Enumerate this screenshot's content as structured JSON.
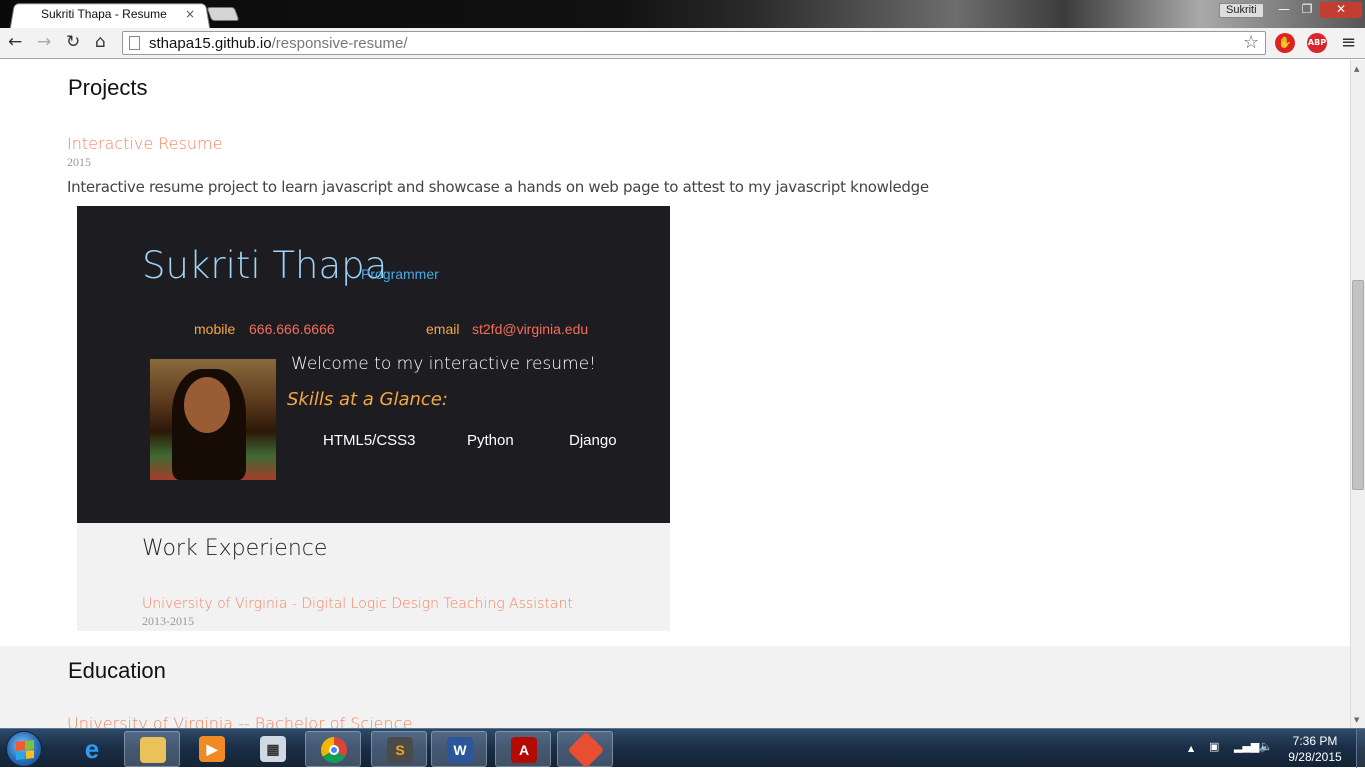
{
  "browser": {
    "tab_title": "Sukriti Thapa - Resume",
    "tab_close": "×",
    "profile_name": "Sukriti",
    "url_domain": "sthapa15.github.io",
    "url_path": "/responsive-resume/",
    "window_min": "—",
    "window_max": "❐",
    "window_close": "✕",
    "back": "←",
    "forward": "→",
    "reload": "↻",
    "home": "⌂",
    "star": "☆",
    "menu": "≡",
    "ext_stop": "✋",
    "ext_abp": "ABP",
    "icons": [
      "back-icon",
      "forward-icon",
      "reload-icon",
      "home-icon",
      "page-icon",
      "star-icon",
      "adblock-icon",
      "menu-icon"
    ]
  },
  "page": {
    "projects_title": "Projects",
    "project": {
      "title": "Interactive Resume",
      "date": "2015",
      "description": "Interactive resume project to learn javascript and showcase a hands on web page to attest to my javascript knowledge"
    },
    "preview": {
      "name": "Sukriti Thapa",
      "role": "Programmer",
      "mobile_label": "mobile",
      "mobile_value": "666.666.6666",
      "email_label": "email",
      "email_value": "st2fd@virginia.edu",
      "welcome": "Welcome to my interactive resume!",
      "skills_title": "Skills at a Glance:",
      "skills": [
        "HTML5/CSS3",
        "Python",
        "Django"
      ],
      "work_title": "Work Experience",
      "work_link": "University of Virginia - Digital Logic Design Teaching Assistant",
      "work_date": "2013-2015"
    },
    "education_title": "Education",
    "education_link": "University of Virginia -- Bachelor of Science"
  },
  "taskbar": {
    "apps": [
      "Internet Explorer",
      "Windows Explorer",
      "Media Player",
      "Calculator",
      "Google Chrome",
      "Sublime Text",
      "Microsoft Word",
      "Adobe Reader",
      "Git"
    ],
    "tray_arrow": "▲",
    "time": "7:36 PM",
    "date": "9/28/2015"
  },
  "colors": {
    "accent_orange": "#f5845e",
    "preview_dark": "#1d1c21",
    "name_blue": "#9fd4f6",
    "label_amber": "#f5a742"
  }
}
